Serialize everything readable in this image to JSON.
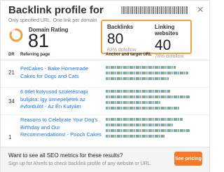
{
  "header": {
    "title": "Backlink profile for ",
    "close_icon": "×",
    "subtitle": "Only specified URL. One link per domain"
  },
  "domain_rating": {
    "label": "Domain Rating",
    "value": "81",
    "ring_fraction": 0.81
  },
  "metrics": {
    "backlinks": {
      "label": "Backlinks",
      "value": "80",
      "sub": "83% dofollow"
    },
    "linking_websites": {
      "label": "Linking websites",
      "value": "40",
      "sub": "78% dofollow"
    }
  },
  "table": {
    "headers": [
      "DR",
      "Referring page",
      "Anchor and target URL"
    ],
    "rows": [
      {
        "dr": "21",
        "title": "PetCakes - Bake Homemade Cakes for Dogs and Cats"
      },
      {
        "dr": "34",
        "title": "6 ötlet kutyusod születésnapi bulijára: így ünnepeljétek az évfordulót - Az Én Kutyám"
      },
      {
        "dr": "1",
        "title": "Reasons to Celebrate Your Dog's Birthday and Our Recommendations! - Pooch Cakes"
      }
    ]
  },
  "footer": {
    "question": "Want to see all SEO metrics for these results?",
    "signup": "Sign up for Ahrefs to check backlink profile of any website or URL.",
    "button": "See pricing"
  },
  "colors": {
    "accent": "#f47a2a",
    "highlight_border": "#f2a23a",
    "link": "#1a73e8"
  }
}
